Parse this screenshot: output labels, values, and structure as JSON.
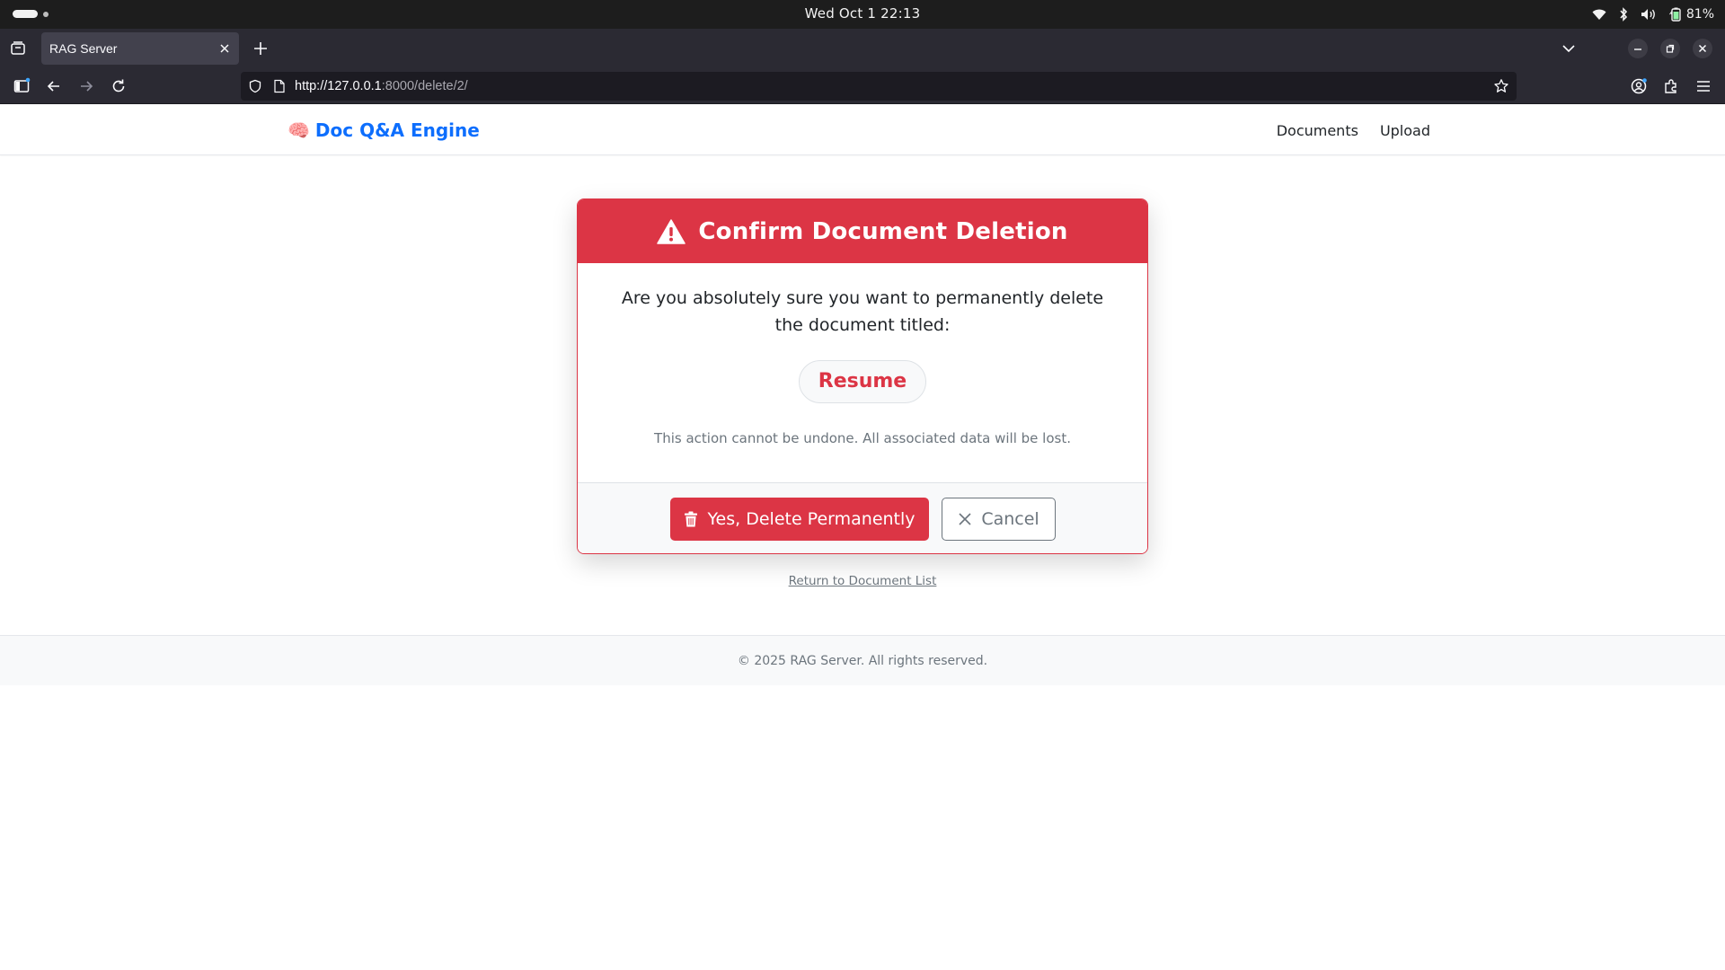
{
  "system": {
    "datetime": "Wed Oct 1  22:13",
    "battery": "81%"
  },
  "browser": {
    "tab_title": "RAG Server",
    "url_host": "http://127.0.0.1",
    "url_rest": ":8000/delete/2/"
  },
  "site": {
    "brand_emoji": "🧠",
    "brand_name": "Doc Q&A Engine",
    "nav": [
      "Documents",
      "Upload"
    ]
  },
  "dialog": {
    "title": "Confirm Document Deletion",
    "question": "Are you absolutely sure you want to permanently delete the document titled:",
    "document_title": "Resume",
    "warning": "This action cannot be undone. All associated data will be lost.",
    "delete_label": "Yes, Delete Permanently",
    "cancel_label": "Cancel"
  },
  "return_link": "Return to Document List",
  "footer": "© 2025 RAG Server. All rights reserved.",
  "colors": {
    "danger": "#dc3545",
    "brand": "#0d6efd",
    "secondary": "#6c757d"
  },
  "icons": [
    "warning-triangle-icon",
    "trash-icon",
    "close-x-icon"
  ]
}
